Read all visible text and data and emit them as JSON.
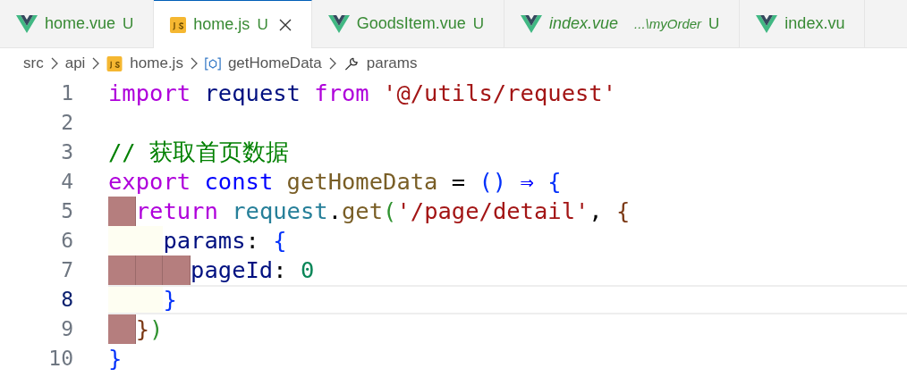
{
  "tabs": [
    {
      "kind": "vue",
      "label": "home.vue",
      "status": "U",
      "italic": false,
      "selected": false,
      "closable": false
    },
    {
      "kind": "js",
      "label": "home.js",
      "status": "U",
      "italic": false,
      "selected": true,
      "closable": true
    },
    {
      "kind": "vue",
      "label": "GoodsItem.vue",
      "status": "U",
      "italic": false,
      "selected": false,
      "closable": false
    },
    {
      "kind": "vue",
      "label": "index.vue",
      "description": "...\\myOrder",
      "status": "U",
      "italic": true,
      "selected": false,
      "closable": false
    },
    {
      "kind": "vue",
      "label": "index.vu",
      "italic": false,
      "selected": false,
      "closable": false
    }
  ],
  "breadcrumb": [
    {
      "label": "src"
    },
    {
      "label": "api"
    },
    {
      "kind": "js",
      "label": "home.js"
    },
    {
      "kind": "symbol",
      "label": "getHomeData"
    },
    {
      "kind": "property",
      "label": "params"
    }
  ],
  "lines": [
    {
      "number": "1",
      "current": false,
      "tokens": [
        {
          "kind": "keyword",
          "text": "import"
        },
        {
          "kind": "variable",
          "text": "request",
          "space": true
        },
        {
          "kind": "keyword",
          "text": "from",
          "space": true
        },
        {
          "kind": "string",
          "text": "'@/utils/request'",
          "space": true
        }
      ]
    },
    {
      "number": "2",
      "current": false
    },
    {
      "number": "3",
      "current": false,
      "tokens": [
        {
          "kind": "comment",
          "text": "// 获取首页数据"
        }
      ]
    },
    {
      "number": "4",
      "current": false,
      "tokens": [
        {
          "kind": "keyword",
          "text": "export"
        },
        {
          "kind": "storage",
          "text": "const",
          "space": true
        },
        {
          "kind": "function",
          "text": "getHomeData",
          "space": true
        },
        {
          "kind": "plain",
          "text": "=",
          "space": true
        },
        {
          "kind": "bracket1",
          "text": "()",
          "space": true
        },
        {
          "kind": "storage",
          "text": "⇒",
          "space": true
        },
        {
          "kind": "bracket1",
          "text": "{",
          "space": true
        }
      ]
    },
    {
      "number": "5",
      "current": false,
      "indents": [
        {
          "kind": "error"
        }
      ],
      "tokens": [
        {
          "kind": "keyword",
          "text": "return"
        },
        {
          "kind": "object",
          "text": "request",
          "space": true
        },
        {
          "kind": "plain",
          "text": "."
        },
        {
          "kind": "function",
          "text": "get"
        },
        {
          "kind": "bracket2",
          "text": "("
        },
        {
          "kind": "string",
          "text": "'/page/detail'"
        },
        {
          "kind": "plain",
          "text": ","
        },
        {
          "kind": "bracket3",
          "text": "{",
          "space": true
        }
      ]
    },
    {
      "number": "6",
      "current": false,
      "indents": [
        {
          "kind": "ok"
        },
        {
          "kind": "ok"
        }
      ],
      "tokens": [
        {
          "kind": "variable",
          "text": "params"
        },
        {
          "kind": "plain",
          "text": ":"
        },
        {
          "kind": "bracket1",
          "text": "{",
          "space": true
        }
      ]
    },
    {
      "number": "7",
      "current": false,
      "indents": [
        {
          "kind": "error"
        },
        {
          "kind": "error"
        },
        {
          "kind": "error"
        }
      ],
      "tokens": [
        {
          "kind": "variable",
          "text": "pageId"
        },
        {
          "kind": "plain",
          "text": ":"
        },
        {
          "kind": "number",
          "text": "0",
          "space": true
        }
      ]
    },
    {
      "number": "8",
      "current": true,
      "indents": [
        {
          "kind": "ok"
        },
        {
          "kind": "ok"
        }
      ],
      "tokens": [
        {
          "kind": "bracket1",
          "text": "}"
        }
      ]
    },
    {
      "number": "9",
      "current": false,
      "indents": [
        {
          "kind": "error"
        }
      ],
      "tokens": [
        {
          "kind": "bracket3",
          "text": "}"
        },
        {
          "kind": "bracket2",
          "text": ")"
        }
      ]
    },
    {
      "number": "10",
      "current": false,
      "tokens": [
        {
          "kind": "bracket1",
          "text": "}"
        }
      ]
    }
  ]
}
